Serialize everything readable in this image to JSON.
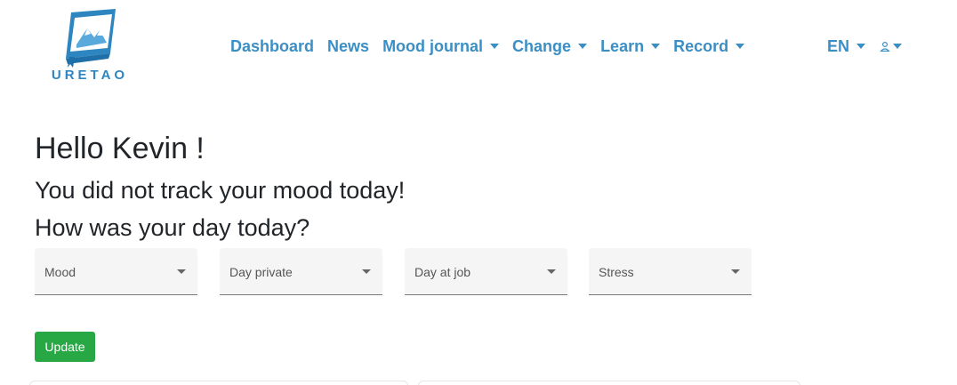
{
  "brand": {
    "name": "URETAO",
    "color": "#2e86c1"
  },
  "nav": {
    "items": [
      {
        "label": "Dashboard",
        "dropdown": false
      },
      {
        "label": "News",
        "dropdown": false
      },
      {
        "label": "Mood journal",
        "dropdown": true
      },
      {
        "label": "Change",
        "dropdown": true
      },
      {
        "label": "Learn",
        "dropdown": true
      },
      {
        "label": "Record",
        "dropdown": true
      }
    ],
    "language": "EN",
    "user_icon": "user-icon",
    "color": "#3b8fc4"
  },
  "main": {
    "greeting": "Hello Kevin !",
    "status": "You did not track your mood today!",
    "question": "How was your day today?",
    "selects": [
      {
        "label": "Mood"
      },
      {
        "label": "Day private"
      },
      {
        "label": "Day at job"
      },
      {
        "label": "Stress"
      }
    ],
    "update_label": "Update",
    "update_color": "#28a745"
  }
}
